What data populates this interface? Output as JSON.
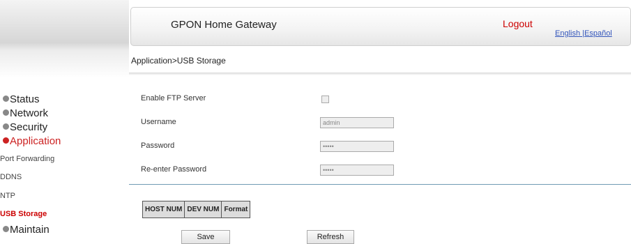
{
  "header": {
    "title": "GPON Home Gateway",
    "logout": "Logout",
    "lang_english": "English",
    "lang_separator": " |",
    "lang_espanol": "Español"
  },
  "breadcrumb": "Application>USB Storage",
  "sidebar": {
    "items": [
      {
        "label": "Status"
      },
      {
        "label": "Network"
      },
      {
        "label": "Security"
      },
      {
        "label": "Application"
      }
    ],
    "subitems": [
      {
        "label": "Port Forwarding"
      },
      {
        "label": "DDNS"
      },
      {
        "label": "NTP"
      },
      {
        "label": "USB Storage"
      }
    ],
    "maintain": "Maintain"
  },
  "form": {
    "enable_ftp_label": "Enable FTP Server",
    "enable_ftp_checked": false,
    "username_label": "Username",
    "username_value": "admin",
    "password_label": "Password",
    "password_value": "•••••",
    "reenter_label": "Re-enter Password",
    "reenter_value": "•••••"
  },
  "table": {
    "headers": [
      "HOST NUM",
      "DEV NUM",
      "Format"
    ]
  },
  "buttons": {
    "save": "Save",
    "refresh": "Refresh"
  },
  "colors": {
    "accent_red": "#cc0000",
    "link_blue": "#3355bb",
    "separator_blue": "#6f9ab3"
  }
}
